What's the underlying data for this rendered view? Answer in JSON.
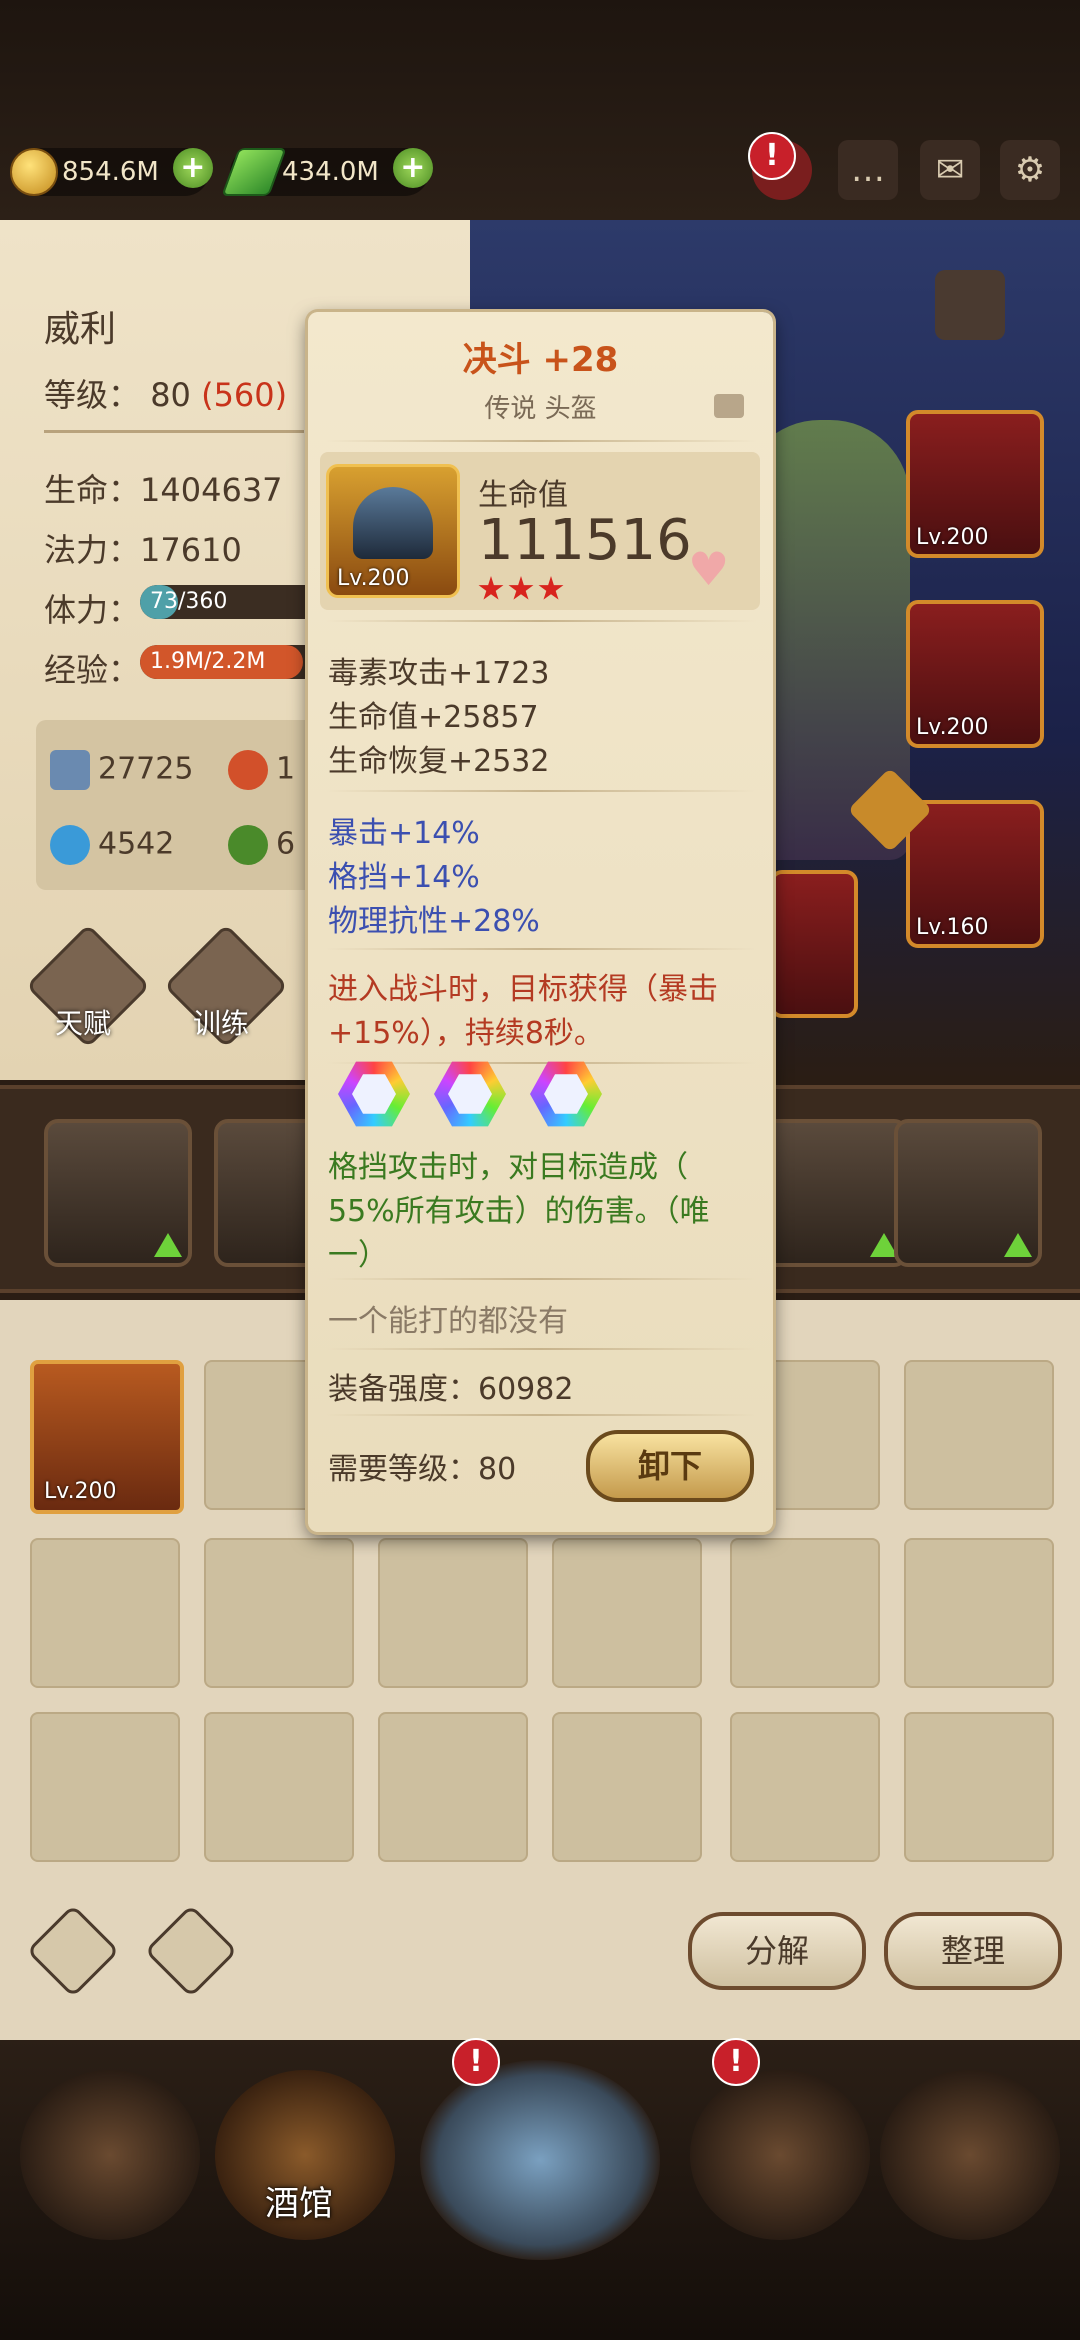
{
  "resources": {
    "gold": "854.6M",
    "gems": "434.0M"
  },
  "topbar": {
    "alert_mark": "!"
  },
  "hero_panel": {
    "name": "威利",
    "level_label": "等级：",
    "level": "80",
    "level_extra": "(560)",
    "hp_label": "生命：",
    "hp": "1404637",
    "mp_label": "法力：",
    "mp": "17610",
    "stamina_label": "体力：",
    "stamina": "73/360",
    "stamina_fraction": 0.2,
    "exp_label": "经验：",
    "exp": "1.9M/2.2M",
    "exp_fraction": 0.86,
    "attack": "27725",
    "fire_partial": "1",
    "defense": "4542",
    "nature_partial": "6",
    "talent_label": "天赋",
    "training_label": "训练"
  },
  "equipment_slots": [
    {
      "level": "Lv.200"
    },
    {
      "level": "Lv.200"
    },
    {
      "level": "Lv.160"
    }
  ],
  "tooltip": {
    "title": "决斗 +28",
    "subtitle": "传说 头盔",
    "item_level": "Lv.200",
    "main_stat_label": "生命值",
    "main_stat_value": "111516",
    "stars": 3,
    "base_stats": [
      "毒素攻击+1723",
      "生命值+25857",
      "生命恢复+2532"
    ],
    "bonus_stats": [
      "暴击+14%",
      "格挡+14%",
      "物理抗性+28%"
    ],
    "proc_effect": [
      "进入战斗时，目标获得（暴击",
      "+15%），持续8秒。"
    ],
    "gems": 3,
    "unique_effect": [
      "格挡攻击时，对目标造成（",
      "55%所有攻击）的伤害。（唯",
      "一）"
    ],
    "flavor": "一个能打的都没有",
    "power_label": "装备强度：",
    "power": "60982",
    "req_label": "需要等级：",
    "req_level": "80",
    "unequip_label": "卸下"
  },
  "inventory": {
    "first_item_level": "Lv.200",
    "decompose_label": "分解",
    "sort_label": "整理"
  },
  "bottom_nav": {
    "tavern_label": "酒馆",
    "alert_mark": "!"
  },
  "colors": {
    "title": "#c8531a",
    "bonus": "#3b4fb0",
    "proc": "#b43a22",
    "unique": "#3a7a20",
    "accent": "#d8241e"
  }
}
